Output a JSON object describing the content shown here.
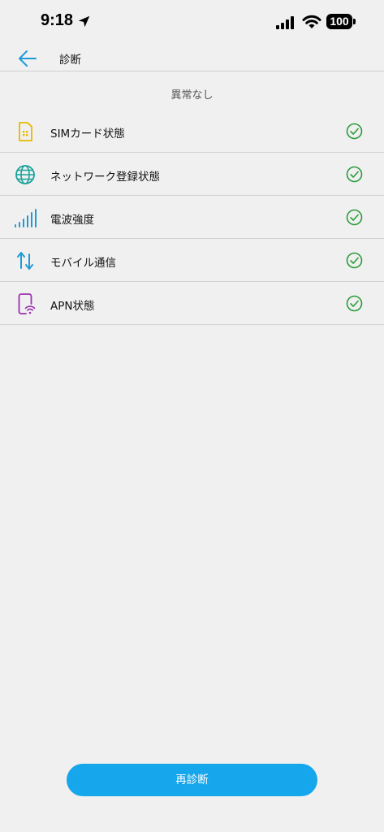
{
  "status_bar": {
    "time": "9:18",
    "battery": "100",
    "icons": [
      "location-arrow-icon",
      "cellular-signal-icon",
      "wifi-icon",
      "battery-icon"
    ]
  },
  "header": {
    "back_icon": "arrow-left-icon",
    "title": "診断"
  },
  "summary": "異常なし",
  "items": [
    {
      "label": "SIMカード状態",
      "icon": "sim-card-icon",
      "icon_color": "#e8b800",
      "status_icon": "check-circle-icon"
    },
    {
      "label": "ネットワーク登録状態",
      "icon": "globe-icon",
      "icon_color": "#18a39a",
      "status_icon": "check-circle-icon"
    },
    {
      "label": "電波強度",
      "icon": "signal-bars-icon",
      "icon_color": "#1e9bd7",
      "status_icon": "check-circle-icon"
    },
    {
      "label": "モバイル通信",
      "icon": "data-arrows-icon",
      "icon_color": "#1e9bd7",
      "status_icon": "check-circle-icon"
    },
    {
      "label": "APN状態",
      "icon": "phone-wifi-icon",
      "icon_color": "#9c2fb0",
      "status_icon": "check-circle-icon"
    }
  ],
  "colors": {
    "accent": "#16a6ec",
    "check": "#2a9d3a",
    "background": "#f0f0f0"
  },
  "button": {
    "label": "再診断"
  }
}
